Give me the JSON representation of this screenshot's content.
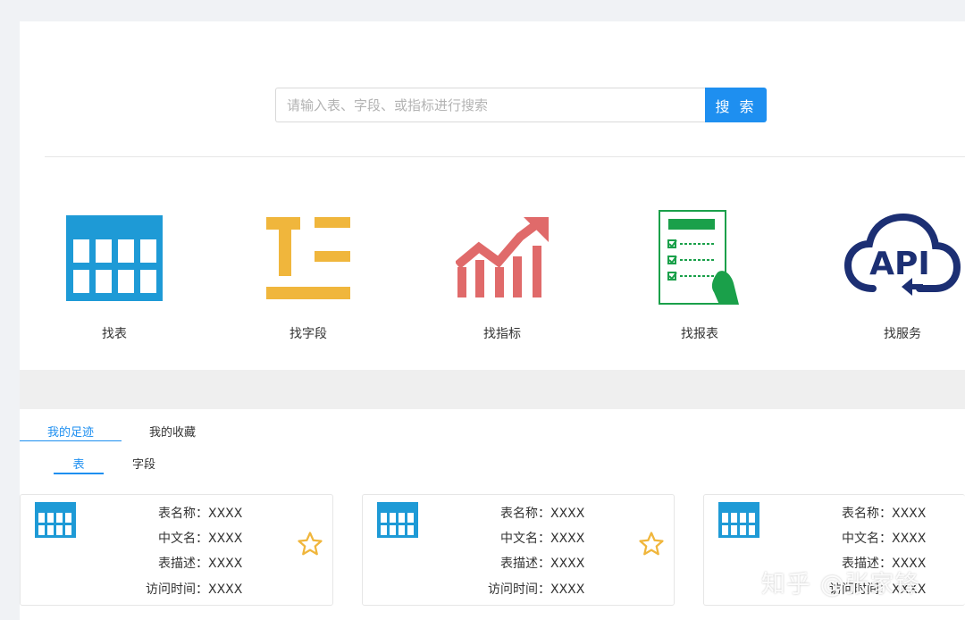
{
  "search": {
    "placeholder": "请输入表、字段、或指标进行搜索",
    "button_label": "搜 索"
  },
  "categories": [
    {
      "label": "找表",
      "icon": "table-grid-icon"
    },
    {
      "label": "找字段",
      "icon": "field-icon"
    },
    {
      "label": "找指标",
      "icon": "trend-chart-icon"
    },
    {
      "label": "找报表",
      "icon": "report-icon"
    },
    {
      "label": "找服务",
      "icon": "api-cloud-icon"
    }
  ],
  "tabs": [
    {
      "label": "我的足迹",
      "active": true
    },
    {
      "label": "我的收藏",
      "active": false
    }
  ],
  "subtabs": [
    {
      "label": "表",
      "active": true
    },
    {
      "label": "字段",
      "active": false
    }
  ],
  "cards": [
    {
      "rows": [
        {
          "key": "表名称：",
          "value": "XXXX"
        },
        {
          "key": "中文名：",
          "value": "XXXX"
        },
        {
          "key": "表描述：",
          "value": "XXXX"
        },
        {
          "key": "访问时间：",
          "value": "XXXX"
        }
      ]
    },
    {
      "rows": [
        {
          "key": "表名称：",
          "value": "XXXX"
        },
        {
          "key": "中文名：",
          "value": "XXXX"
        },
        {
          "key": "表描述：",
          "value": "XXXX"
        },
        {
          "key": "访问时间：",
          "value": "XXXX"
        }
      ]
    },
    {
      "rows": [
        {
          "key": "表名称：",
          "value": "XXXX"
        },
        {
          "key": "中文名：",
          "value": "XXXX"
        },
        {
          "key": "表描述：",
          "value": "XXXX"
        },
        {
          "key": "访问时间：",
          "value": "XXXX"
        }
      ]
    }
  ],
  "watermark": "知乎 @张家锋",
  "colors": {
    "accent": "#1e8ff0",
    "table_icon": "#1e9ad6",
    "field_icon": "#f0b63c",
    "chart_icon": "#e06a6a",
    "report_icon": "#1aa04a",
    "api_icon": "#1c2f73",
    "star": "#f0b63c"
  }
}
